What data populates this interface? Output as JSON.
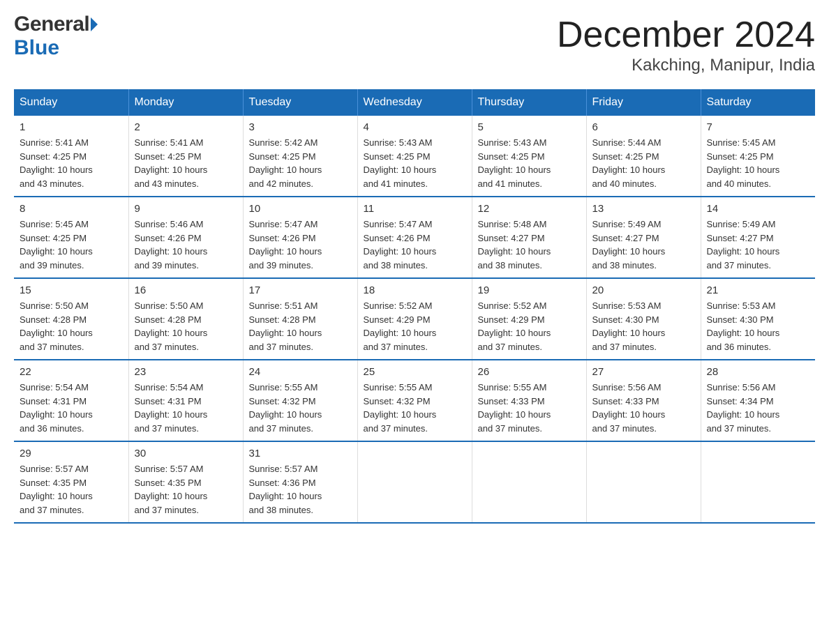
{
  "logo": {
    "general": "General",
    "blue": "Blue"
  },
  "title": {
    "month": "December 2024",
    "location": "Kakching, Manipur, India"
  },
  "headers": [
    "Sunday",
    "Monday",
    "Tuesday",
    "Wednesday",
    "Thursday",
    "Friday",
    "Saturday"
  ],
  "weeks": [
    [
      {
        "day": "1",
        "info": "Sunrise: 5:41 AM\nSunset: 4:25 PM\nDaylight: 10 hours\nand 43 minutes."
      },
      {
        "day": "2",
        "info": "Sunrise: 5:41 AM\nSunset: 4:25 PM\nDaylight: 10 hours\nand 43 minutes."
      },
      {
        "day": "3",
        "info": "Sunrise: 5:42 AM\nSunset: 4:25 PM\nDaylight: 10 hours\nand 42 minutes."
      },
      {
        "day": "4",
        "info": "Sunrise: 5:43 AM\nSunset: 4:25 PM\nDaylight: 10 hours\nand 41 minutes."
      },
      {
        "day": "5",
        "info": "Sunrise: 5:43 AM\nSunset: 4:25 PM\nDaylight: 10 hours\nand 41 minutes."
      },
      {
        "day": "6",
        "info": "Sunrise: 5:44 AM\nSunset: 4:25 PM\nDaylight: 10 hours\nand 40 minutes."
      },
      {
        "day": "7",
        "info": "Sunrise: 5:45 AM\nSunset: 4:25 PM\nDaylight: 10 hours\nand 40 minutes."
      }
    ],
    [
      {
        "day": "8",
        "info": "Sunrise: 5:45 AM\nSunset: 4:25 PM\nDaylight: 10 hours\nand 39 minutes."
      },
      {
        "day": "9",
        "info": "Sunrise: 5:46 AM\nSunset: 4:26 PM\nDaylight: 10 hours\nand 39 minutes."
      },
      {
        "day": "10",
        "info": "Sunrise: 5:47 AM\nSunset: 4:26 PM\nDaylight: 10 hours\nand 39 minutes."
      },
      {
        "day": "11",
        "info": "Sunrise: 5:47 AM\nSunset: 4:26 PM\nDaylight: 10 hours\nand 38 minutes."
      },
      {
        "day": "12",
        "info": "Sunrise: 5:48 AM\nSunset: 4:27 PM\nDaylight: 10 hours\nand 38 minutes."
      },
      {
        "day": "13",
        "info": "Sunrise: 5:49 AM\nSunset: 4:27 PM\nDaylight: 10 hours\nand 38 minutes."
      },
      {
        "day": "14",
        "info": "Sunrise: 5:49 AM\nSunset: 4:27 PM\nDaylight: 10 hours\nand 37 minutes."
      }
    ],
    [
      {
        "day": "15",
        "info": "Sunrise: 5:50 AM\nSunset: 4:28 PM\nDaylight: 10 hours\nand 37 minutes."
      },
      {
        "day": "16",
        "info": "Sunrise: 5:50 AM\nSunset: 4:28 PM\nDaylight: 10 hours\nand 37 minutes."
      },
      {
        "day": "17",
        "info": "Sunrise: 5:51 AM\nSunset: 4:28 PM\nDaylight: 10 hours\nand 37 minutes."
      },
      {
        "day": "18",
        "info": "Sunrise: 5:52 AM\nSunset: 4:29 PM\nDaylight: 10 hours\nand 37 minutes."
      },
      {
        "day": "19",
        "info": "Sunrise: 5:52 AM\nSunset: 4:29 PM\nDaylight: 10 hours\nand 37 minutes."
      },
      {
        "day": "20",
        "info": "Sunrise: 5:53 AM\nSunset: 4:30 PM\nDaylight: 10 hours\nand 37 minutes."
      },
      {
        "day": "21",
        "info": "Sunrise: 5:53 AM\nSunset: 4:30 PM\nDaylight: 10 hours\nand 36 minutes."
      }
    ],
    [
      {
        "day": "22",
        "info": "Sunrise: 5:54 AM\nSunset: 4:31 PM\nDaylight: 10 hours\nand 36 minutes."
      },
      {
        "day": "23",
        "info": "Sunrise: 5:54 AM\nSunset: 4:31 PM\nDaylight: 10 hours\nand 37 minutes."
      },
      {
        "day": "24",
        "info": "Sunrise: 5:55 AM\nSunset: 4:32 PM\nDaylight: 10 hours\nand 37 minutes."
      },
      {
        "day": "25",
        "info": "Sunrise: 5:55 AM\nSunset: 4:32 PM\nDaylight: 10 hours\nand 37 minutes."
      },
      {
        "day": "26",
        "info": "Sunrise: 5:55 AM\nSunset: 4:33 PM\nDaylight: 10 hours\nand 37 minutes."
      },
      {
        "day": "27",
        "info": "Sunrise: 5:56 AM\nSunset: 4:33 PM\nDaylight: 10 hours\nand 37 minutes."
      },
      {
        "day": "28",
        "info": "Sunrise: 5:56 AM\nSunset: 4:34 PM\nDaylight: 10 hours\nand 37 minutes."
      }
    ],
    [
      {
        "day": "29",
        "info": "Sunrise: 5:57 AM\nSunset: 4:35 PM\nDaylight: 10 hours\nand 37 minutes."
      },
      {
        "day": "30",
        "info": "Sunrise: 5:57 AM\nSunset: 4:35 PM\nDaylight: 10 hours\nand 37 minutes."
      },
      {
        "day": "31",
        "info": "Sunrise: 5:57 AM\nSunset: 4:36 PM\nDaylight: 10 hours\nand 38 minutes."
      },
      {
        "day": "",
        "info": ""
      },
      {
        "day": "",
        "info": ""
      },
      {
        "day": "",
        "info": ""
      },
      {
        "day": "",
        "info": ""
      }
    ]
  ]
}
